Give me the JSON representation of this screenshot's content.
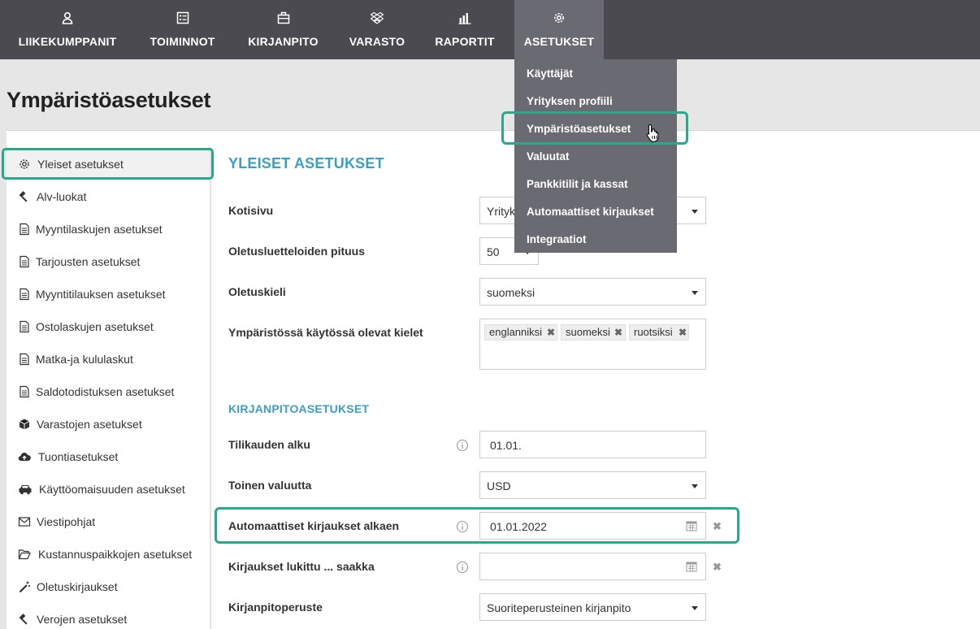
{
  "topnav": {
    "items": [
      {
        "label": "LIIKEKUMPPANIT",
        "icon": "person-icon"
      },
      {
        "label": "TOIMINNOT",
        "icon": "list-icon"
      },
      {
        "label": "KIRJANPITO",
        "icon": "briefcase-icon"
      },
      {
        "label": "VARASTO",
        "icon": "dropbox-icon"
      },
      {
        "label": "RAPORTIT",
        "icon": "bar-chart-icon"
      },
      {
        "label": "ASETUKSET",
        "icon": "gear-icon"
      }
    ]
  },
  "dropdown": {
    "items": [
      "Käyttäjät",
      "Yrityksen profiili",
      "Ympäristöasetukset",
      "Valuutat",
      "Pankkitilit ja kassat",
      "Automaattiset kirjaukset",
      "Integraatiot"
    ]
  },
  "page": {
    "title": "Ympäristöasetukset"
  },
  "sidebar": {
    "items": [
      {
        "label": "Yleiset asetukset",
        "icon": "gear-icon"
      },
      {
        "label": "Alv-luokat",
        "icon": "gavel-icon"
      },
      {
        "label": "Myyntilaskujen asetukset",
        "icon": "document-icon"
      },
      {
        "label": "Tarjousten asetukset",
        "icon": "document-icon"
      },
      {
        "label": "Myyntitilauksen asetukset",
        "icon": "document-icon"
      },
      {
        "label": "Ostolaskujen asetukset",
        "icon": "document-icon"
      },
      {
        "label": "Matka-ja kululaskut",
        "icon": "document-icon"
      },
      {
        "label": "Saldotodistuksen asetukset",
        "icon": "document-icon"
      },
      {
        "label": "Varastojen asetukset",
        "icon": "cube-icon"
      },
      {
        "label": "Tuontiasetukset",
        "icon": "cloud-upload-icon"
      },
      {
        "label": "Käyttöomaisuuden asetukset",
        "icon": "car-icon"
      },
      {
        "label": "Viestipohjat",
        "icon": "envelope-icon"
      },
      {
        "label": "Kustannuspaikkojen asetukset",
        "icon": "folder-icon"
      },
      {
        "label": "Oletuskirjaukset",
        "icon": "magic-wand-icon"
      },
      {
        "label": "Verojen asetukset",
        "icon": "gavel-icon"
      }
    ]
  },
  "main": {
    "section_title": "YLEISET ASETUKSET",
    "subsection_title": "KIRJANPITOASETUKSET",
    "fields": {
      "kotisivu": {
        "label": "Kotisivu",
        "value": "Yrityk"
      },
      "oletusluettelo": {
        "label": "Oletusluetteloiden pituus",
        "value": "50"
      },
      "oletuskieli": {
        "label": "Oletuskieli",
        "value": "suomeksi"
      },
      "kielet": {
        "label": "Ympäristössä käytössä olevat kielet",
        "tags": [
          "englanniksi",
          "suomeksi",
          "ruotsiksi"
        ]
      },
      "tilikausi": {
        "label": "Tilikauden alku",
        "value": "01.01."
      },
      "valuutta": {
        "label": "Toinen valuutta",
        "value": "USD"
      },
      "autokirjaukset": {
        "label": "Automaattiset kirjaukset alkaen",
        "value": "01.01.2022"
      },
      "lukittu": {
        "label": "Kirjaukset lukittu ... saakka",
        "value": ""
      },
      "peruste": {
        "label": "Kirjanpitoperuste",
        "value": "Suoriteperusteinen kirjanpito"
      }
    },
    "clear_symbol": "✖"
  },
  "colors": {
    "nav_bg": "#4a4a50",
    "nav_active": "#6a6a72",
    "accent": "#3a9fc8",
    "highlight": "#2aa88a"
  }
}
